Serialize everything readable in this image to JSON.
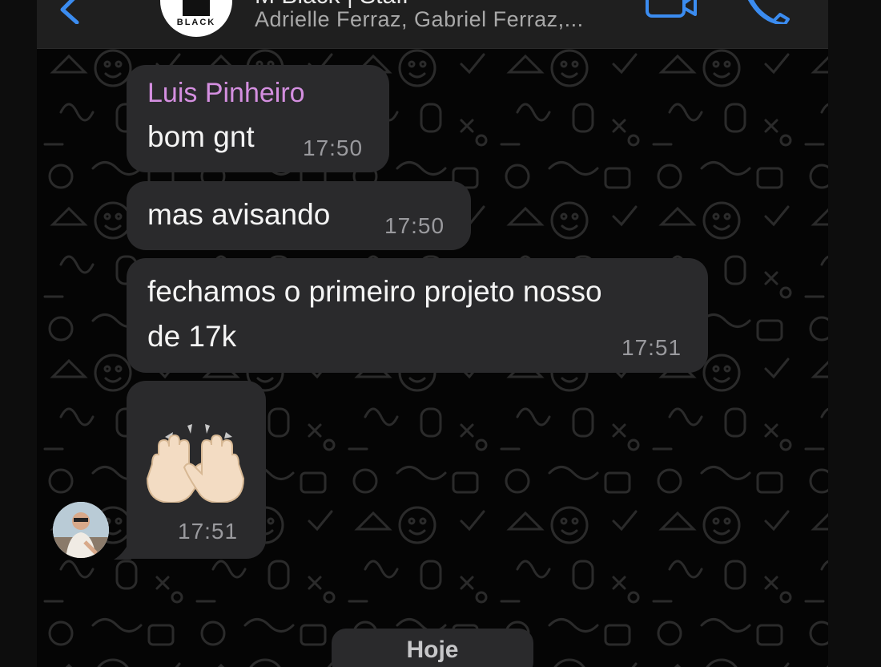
{
  "header": {
    "group_name": "M Black | Staff",
    "group_avatar_text": "BLACK",
    "members": "Adrielle Ferraz, Gabriel Ferraz,..."
  },
  "messages": [
    {
      "sender": "Luis Pinheiro",
      "text": "bom gnt",
      "time": "17:50"
    },
    {
      "text": "mas avisando",
      "time": "17:50"
    },
    {
      "text_line1": "fechamos o primeiro projeto nosso",
      "text_line2": "de 17k",
      "time": "17:51"
    },
    {
      "emoji": "raising-hands",
      "time": "17:51"
    }
  ],
  "date_separator": "Hoje",
  "colors": {
    "sender_name": "#d48fe0",
    "bubble": "#2a2a2c",
    "accent": "#3b8cf0"
  }
}
